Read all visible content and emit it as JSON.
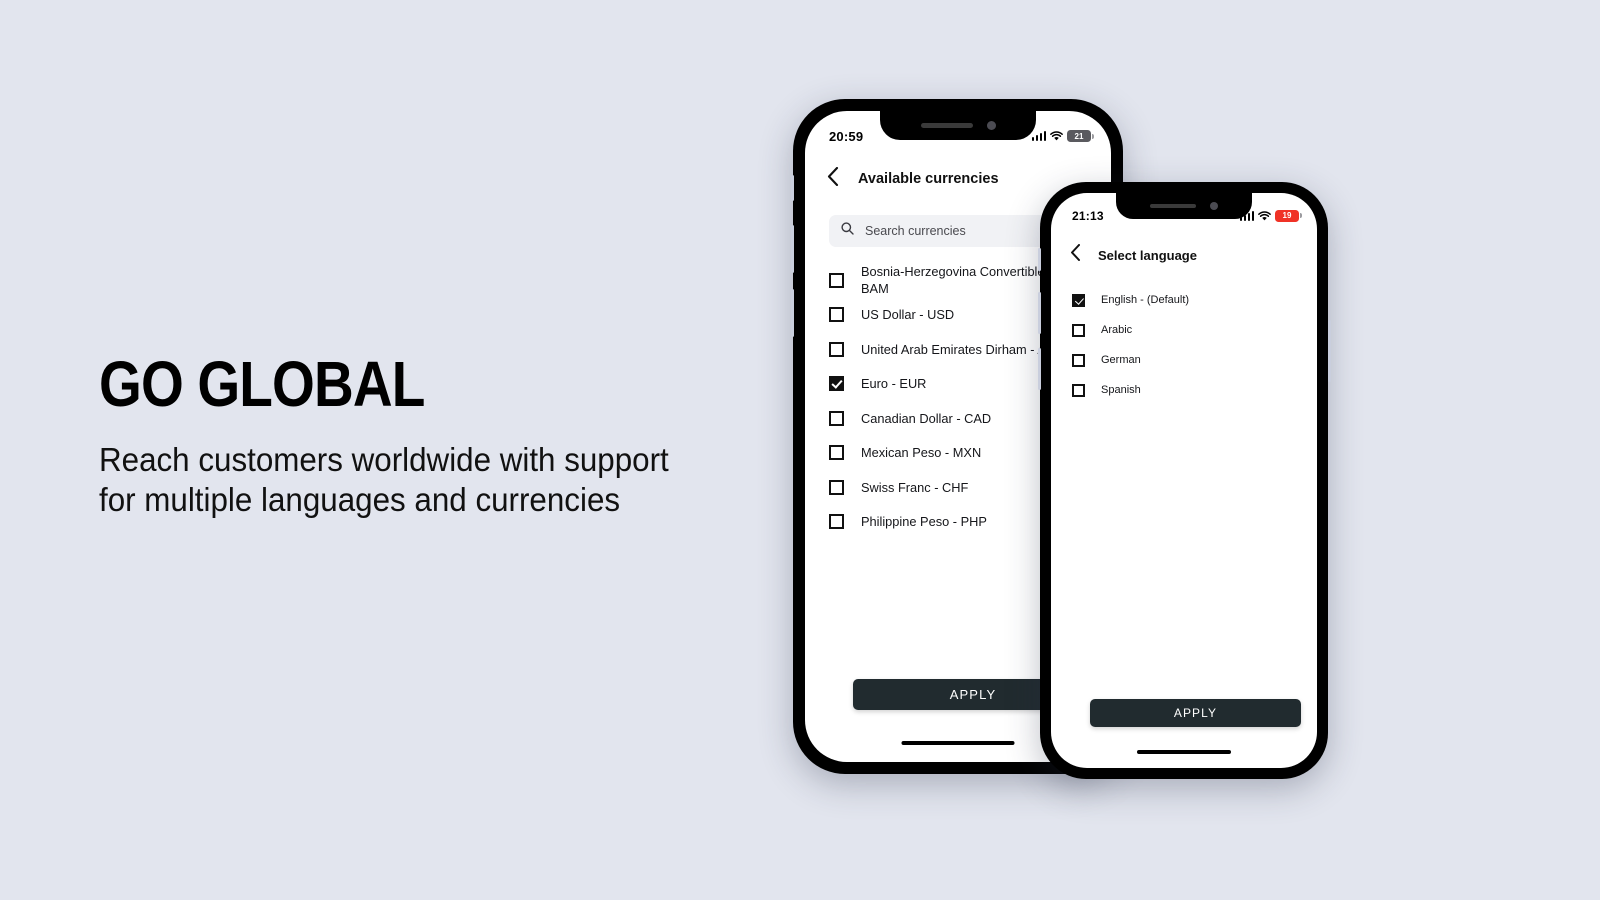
{
  "page": {
    "background_color": "#e2e5ee",
    "headline": "GO GLOBAL",
    "subhead_line_1": "Reach customers worldwide with support",
    "subhead_line_2": "for multiple languages and currencies"
  },
  "phone_currencies": {
    "status_bar": {
      "time": "20:59",
      "battery_level": "21",
      "battery_low": false,
      "cellular_icon": "signal-bars-icon",
      "wifi_icon": "wifi-icon",
      "battery_icon": "battery-icon"
    },
    "header": {
      "back_icon": "chevron-left-icon",
      "title": "Available currencies"
    },
    "search": {
      "icon": "search-icon",
      "placeholder": "Search currencies",
      "value": ""
    },
    "items": [
      {
        "label": "Bosnia-Herzegovina Convertible M\nBAM",
        "checked": false
      },
      {
        "label": "US Dollar - USD",
        "checked": false
      },
      {
        "label": "United Arab Emirates Dirham - AE",
        "checked": false
      },
      {
        "label": "Euro - EUR",
        "checked": true
      },
      {
        "label": "Canadian Dollar - CAD",
        "checked": false
      },
      {
        "label": "Mexican Peso - MXN",
        "checked": false
      },
      {
        "label": "Swiss Franc - CHF",
        "checked": false
      },
      {
        "label": "Philippine Peso - PHP",
        "checked": false
      }
    ],
    "apply_label": "APPLY",
    "apply_color": "#212b2f"
  },
  "phone_languages": {
    "status_bar": {
      "time": "21:13",
      "battery_level": "19",
      "battery_low": true,
      "battery_low_color": "#f03226",
      "cellular_icon": "signal-bars-icon",
      "wifi_icon": "wifi-icon",
      "battery_icon": "battery-icon"
    },
    "header": {
      "back_icon": "chevron-left-icon",
      "title": "Select language"
    },
    "items": [
      {
        "label": "English - (Default)",
        "checked": true
      },
      {
        "label": "Arabic",
        "checked": false
      },
      {
        "label": "German",
        "checked": false
      },
      {
        "label": "Spanish",
        "checked": false
      }
    ],
    "apply_label": "APPLY",
    "apply_color": "#212b2f"
  }
}
